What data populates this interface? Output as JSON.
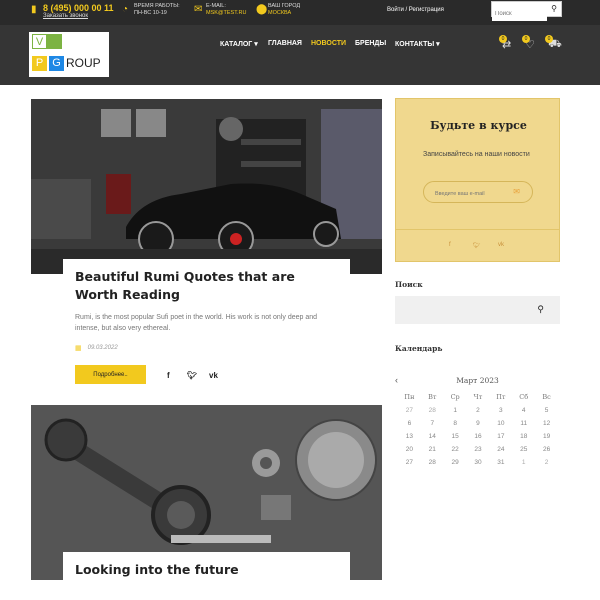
{
  "topbar": {
    "phone": "8 (495) 000 00 11",
    "callback": "Заказать звонок",
    "hours_label": "Время работы:",
    "hours_value": "ПН-ВС 10-19",
    "email_label": "E-mail:",
    "email_value": "msk@test.ru",
    "city_label": "Ваш город",
    "city_value": "Москва",
    "login": "Войти / Регистрация",
    "search_placeholder": "Поиск"
  },
  "header": {
    "logo": {
      "v": "V",
      "p": "P",
      "g": "G",
      "group": "ROUP"
    },
    "nav": [
      {
        "label": "КАТАЛОГ ▾"
      },
      {
        "label": "ГЛАВНАЯ"
      },
      {
        "label": "НОВОСТИ"
      },
      {
        "label": "БРЕНДЫ"
      },
      {
        "label": "КОНТАКТЫ ▾"
      }
    ],
    "badges": [
      "0",
      "0",
      "0"
    ],
    "active_color": "#f2c91e"
  },
  "posts": [
    {
      "title": "Beautiful Rumi Quotes that are Worth Reading",
      "excerpt": "Rumi, is the most popular Sufi poet in the world. His work is not only deep and intense, but also very ethereal.",
      "date": "09.03.2022",
      "button": "Подробнее.."
    },
    {
      "title": "Looking into the future"
    }
  ],
  "sidebar": {
    "subscribe_title": "Будьте в курсе",
    "subscribe_text": "Записывайтесь на наши новости",
    "email_placeholder": "Введите ваш e-mail",
    "search_heading": "Поиск",
    "calendar_heading": "Календарь",
    "calendar_month": "Март 2023",
    "weekdays": [
      "Пн",
      "Вт",
      "Ср",
      "Чт",
      "Пт",
      "Сб",
      "Вс"
    ],
    "days": [
      [
        "27",
        "28",
        "1",
        "2",
        "3",
        "4",
        "5"
      ],
      [
        "6",
        "7",
        "8",
        "9",
        "10",
        "11",
        "12"
      ],
      [
        "13",
        "14",
        "15",
        "16",
        "17",
        "18",
        "19"
      ],
      [
        "20",
        "21",
        "22",
        "23",
        "24",
        "25",
        "26"
      ],
      [
        "27",
        "28",
        "29",
        "30",
        "31",
        "1",
        "2"
      ]
    ]
  }
}
